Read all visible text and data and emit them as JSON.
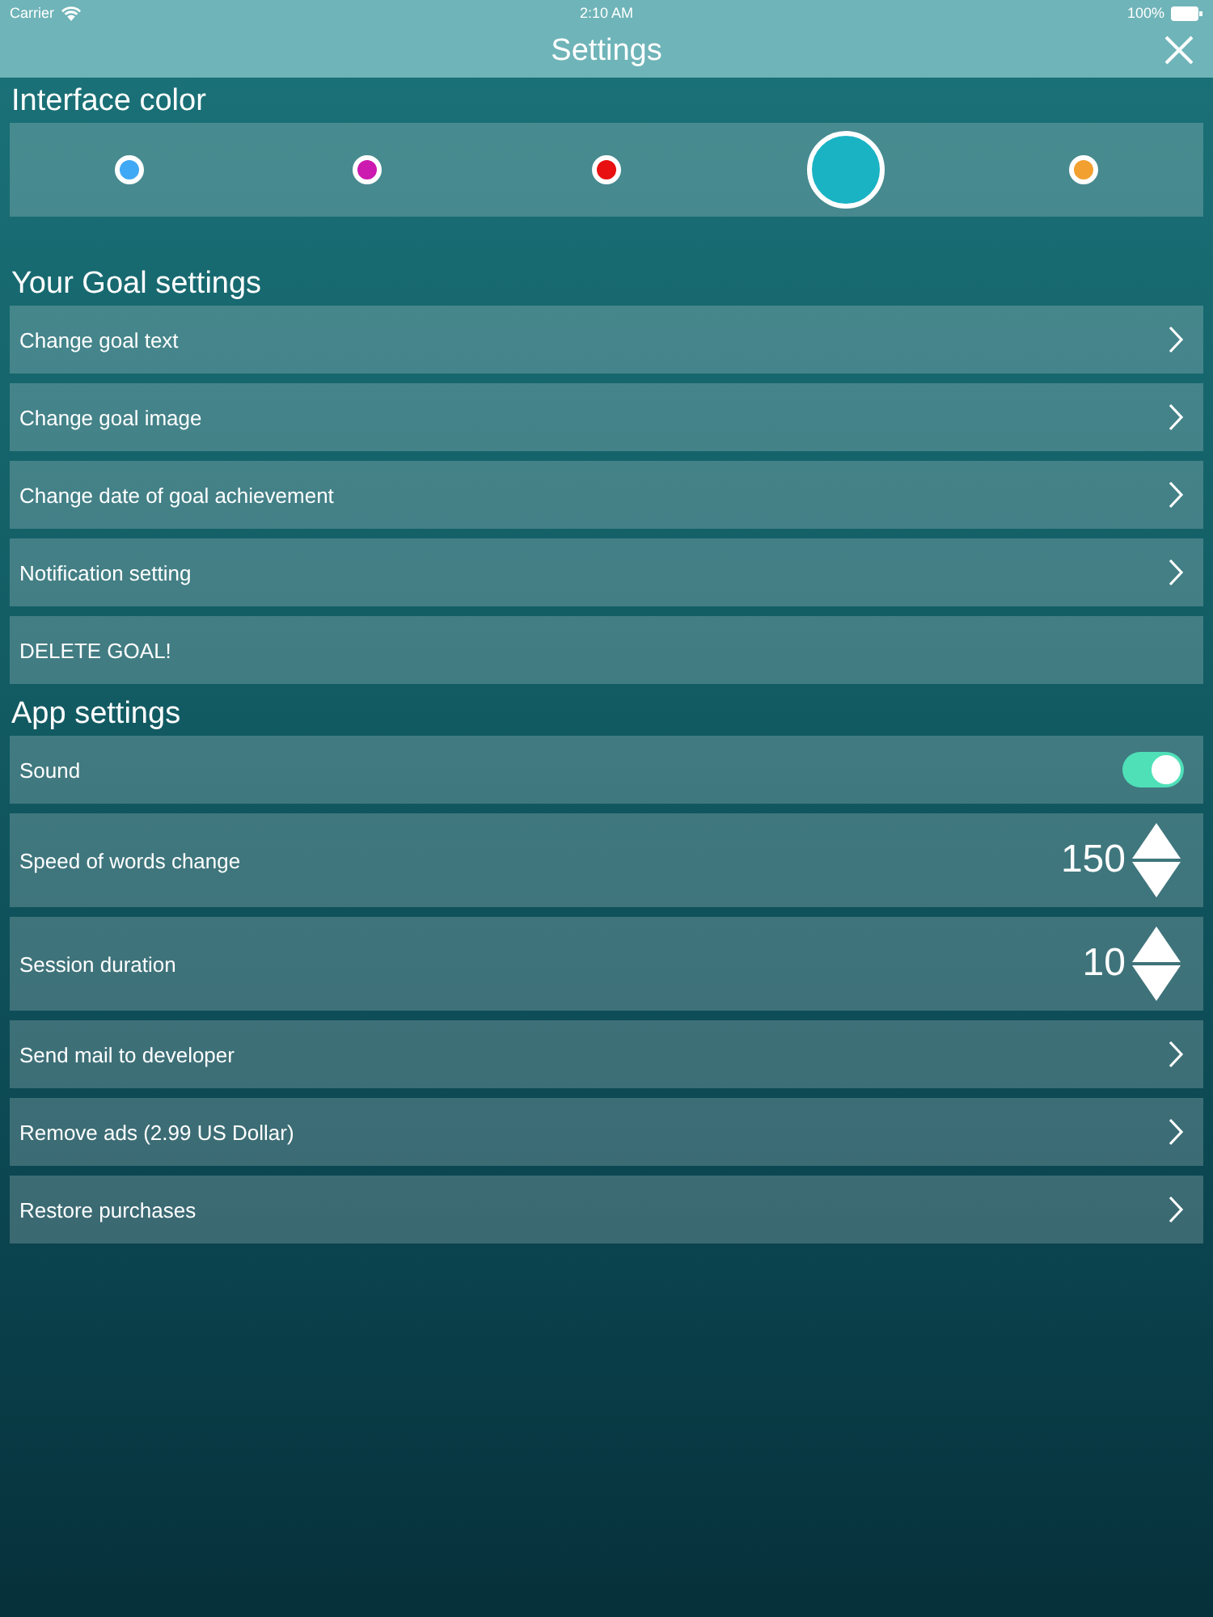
{
  "status_bar": {
    "carrier": "Carrier",
    "time": "2:10 AM",
    "battery": "100%"
  },
  "nav_bar": {
    "title": "Settings"
  },
  "interface_color": {
    "title": "Interface color",
    "colors": [
      {
        "color": "#3fa9f5",
        "selected": false
      },
      {
        "color": "#cc19b0",
        "selected": false
      },
      {
        "color": "#e81010",
        "selected": false
      },
      {
        "color": "#1ab3c4",
        "selected": true
      },
      {
        "color": "#f2a030",
        "selected": false
      }
    ]
  },
  "goal_settings": {
    "title": "Your Goal settings",
    "items": [
      {
        "kind": "link",
        "label": "Change goal text"
      },
      {
        "kind": "link",
        "label": "Change goal image"
      },
      {
        "kind": "link",
        "label": "Change date of goal achievement"
      },
      {
        "kind": "link",
        "label": "Notification setting"
      },
      {
        "kind": "plain",
        "label": "DELETE GOAL!"
      }
    ]
  },
  "app_settings": {
    "title": "App settings",
    "items": [
      {
        "kind": "toggle",
        "label": "Sound",
        "on": true
      },
      {
        "kind": "stepper",
        "label": "Speed of words change",
        "value": "150"
      },
      {
        "kind": "stepper",
        "label": "Session duration",
        "value": "10"
      },
      {
        "kind": "link",
        "label": "Send mail to developer"
      },
      {
        "kind": "link",
        "label": "Remove ads (2.99 US Dollar)"
      },
      {
        "kind": "link",
        "label": "Restore purchases"
      }
    ]
  }
}
